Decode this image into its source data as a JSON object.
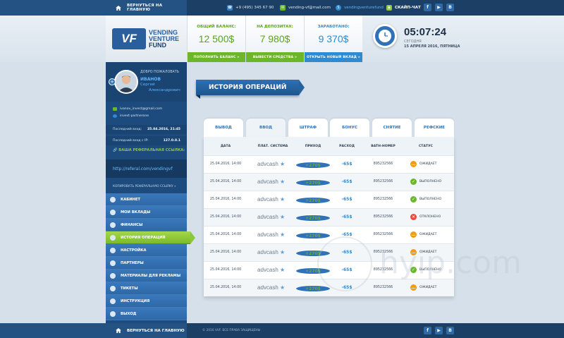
{
  "topbar": {
    "home_label": "ВЕРНУТЬСЯ НА ГЛАВНУЮ",
    "phone": "+9 (495) 345 67 90",
    "email": "vending-vf@mail.com",
    "skype": "vendingventurefund",
    "chat_label": "СКАЙП-ЧАТ"
  },
  "brand": {
    "mark": "VF",
    "line1": "VENDING",
    "line2": "VENTURE",
    "line3": "FUND"
  },
  "stats": [
    {
      "label": "ОБЩИЙ БАЛАНС:",
      "value": "12 500$",
      "button": "ПОПОЛНИТЬ БАЛАНС »",
      "color": "#5ba41c",
      "btn_color": "#6ab72a"
    },
    {
      "label": "НА ДЕПОЗИТАХ:",
      "value": "7 980$",
      "button": "ВЫВЕСТИ СРЕДСТВА »",
      "color": "#5ba41c",
      "btn_color": "#6ab72a"
    },
    {
      "label": "ЗАРАБОТАНО:",
      "value": "9 370$",
      "button": "ОТКРЫТЬ НОВЫЙ ВКЛАД »",
      "color": "#2f8ad0",
      "btn_color": "#2f8ad0"
    }
  ],
  "clock": {
    "time": "05:07:24",
    "today": "СЕГОДНЯ",
    "date": "15 АПРЕЛЯ 2016, ПЯТНИЦА"
  },
  "profile": {
    "welcome": "ДОБРО ПОЖАЛОВАТЬ",
    "last_name": "ИВАНОВ",
    "first_name": "Сергей",
    "patronymic": "Александрович",
    "email": "ivanov_invest@gmail.com",
    "skype": "invest-partnerone",
    "last_login_label": "Последний вход:",
    "last_login_value": "25.04.2016, 21:45",
    "last_ip_label": "Последний вход с IP:",
    "last_ip_value": "127.0.0.1"
  },
  "referral": {
    "title": "ВАША РЕФЕРАЛЬНАЯ ССЫЛКА:",
    "link": "http://referal.com/vendingvf",
    "copy_label": "КОПИРОВАТЬ РЕФЕРАЛЬНУЮ ССЫЛКУ »"
  },
  "menu": [
    {
      "label": "КАБИНЕТ",
      "icon": "user-icon"
    },
    {
      "label": "МОИ ВКЛАДЫ",
      "icon": "bank-icon"
    },
    {
      "label": "ФИНАНСЫ",
      "icon": "wallet-icon"
    },
    {
      "label": "ИСТОРИЯ ОПЕРАЦИЙ",
      "icon": "history-icon",
      "active": true
    },
    {
      "label": "НАСТРОЙКА",
      "icon": "gear-icon"
    },
    {
      "label": "ПАРТНЕРЫ",
      "icon": "partners-icon"
    },
    {
      "label": "МАТЕРИАЛЫ ДЛЯ РЕКЛАМЫ",
      "icon": "megaphone-icon"
    },
    {
      "label": "ТИКЕТЫ",
      "icon": "ticket-icon"
    },
    {
      "label": "ИНСТРУКЦИЯ",
      "icon": "book-icon"
    },
    {
      "label": "ВЫХОД",
      "icon": "logout-icon"
    }
  ],
  "page_title": "ИСТОРИЯ ОПЕРАЦИЙ",
  "tabs": [
    "ВЫВОД",
    "ВВОД",
    "ШТРАФ",
    "БОНУС",
    "СНЯТИЕ",
    "РЕФСКИЕ"
  ],
  "active_tab": 1,
  "table": {
    "headers": [
      "ДАТА",
      "ПЛАТ. СИСТЕМА",
      "ПРИХОД",
      "РАСХОД",
      "BATH-НОМЕР",
      "СТАТУС"
    ],
    "rows": [
      {
        "date": "25.04.2016, 14:00",
        "system": "advcash",
        "income": "+270$",
        "expense": "-65$",
        "batch": "895232566",
        "status": "ОЖИДАЕТ",
        "state": "pending"
      },
      {
        "date": "25.04.2016, 14:00",
        "system": "advcash",
        "income": "+270$",
        "expense": "-65$",
        "batch": "895232566",
        "status": "ВЫПОЛНЕНО",
        "state": "done"
      },
      {
        "date": "25.04.2016, 14:00",
        "system": "advcash",
        "income": "+270$",
        "expense": "-65$",
        "batch": "895232566",
        "status": "ВЫПОЛНЕНО",
        "state": "done"
      },
      {
        "date": "25.04.2016, 14:00",
        "system": "advcash",
        "income": "+270$",
        "expense": "-65$",
        "batch": "895232566",
        "status": "ОТКЛОНЕНО",
        "state": "rejected"
      },
      {
        "date": "25.04.2016, 14:00",
        "system": "advcash",
        "income": "+270$",
        "expense": "-65$",
        "batch": "895232566",
        "status": "ОЖИДАЕТ",
        "state": "pending"
      },
      {
        "date": "25.04.2016, 14:00",
        "system": "advcash",
        "income": "+270$",
        "expense": "-65$",
        "batch": "895232566",
        "status": "ОЖИДАЕТ",
        "state": "pending"
      },
      {
        "date": "25.04.2016, 14:00",
        "system": "advcash",
        "income": "+270$",
        "expense": "-65$",
        "batch": "895232566",
        "status": "ВЫПОЛНЕНО",
        "state": "done"
      },
      {
        "date": "25.04.2016, 14:00",
        "system": "advcash",
        "income": "+270$",
        "expense": "-65$",
        "batch": "895232566",
        "status": "ОЖИДАЕТ",
        "state": "pending"
      }
    ]
  },
  "status_colors": {
    "pending": "#f39c12",
    "done": "#6ab72a",
    "rejected": "#e74c3c"
  },
  "watermark": "hyip.com",
  "footer": {
    "home_label": "ВЕРНУТЬСЯ НА ГЛАВНУЮ",
    "copyright": "© 2016 VVF. ВСЕ ПРАВА ЗАЩИЩЕНЫ"
  },
  "social": [
    "f",
    "▶",
    "B"
  ]
}
